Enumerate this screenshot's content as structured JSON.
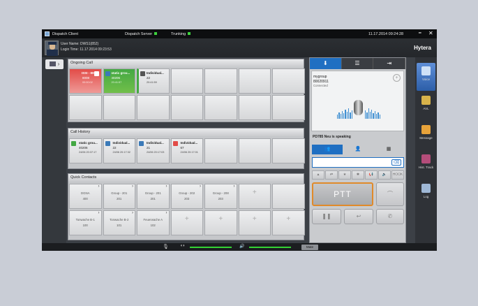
{
  "titlebar": {
    "app_title": "Dispatch Client",
    "server_label": "Dispatch Server",
    "trunking_label": "Trunking",
    "datetime": "11.17.2014 09:24:28",
    "status_color": "#3cd23c"
  },
  "user": {
    "user_name": "User Name: DWS1(852)",
    "login_time": "Login Time: 11.17.2014 09:23:53"
  },
  "brand": "Hytera",
  "ongoing_call": {
    "title": "Ongoing Call",
    "calls": [
      {
        "l1": "ISSI - 8008",
        "l2": "8008",
        "l3": "00:00:02",
        "color": "#e24c48"
      },
      {
        "l1": "static grou...",
        "l2": "40206",
        "l3": "20:41:57",
        "color": "#43a843"
      },
      {
        "l1": "Individual...",
        "l2": "22",
        "l3": "20:41:59",
        "color": "#e6e7e9"
      }
    ]
  },
  "call_history": {
    "title": "Call History",
    "items": [
      {
        "l1": "static grou...",
        "l2": "40206",
        "l3": "24/06 20:37:17"
      },
      {
        "l1": "Individual...",
        "l2": "22",
        "l3": "24/06 20:17:32"
      },
      {
        "l1": "Individual...",
        "l2": "21",
        "l3": "24/06 20:17:03"
      },
      {
        "l1": "Individual...",
        "l2": "67",
        "l3": "24/06 20:17:01"
      }
    ]
  },
  "quick_contacts": {
    "title": "Quick Contacts",
    "row1": [
      {
        "name": "DGNA",
        "id": "400"
      },
      {
        "name": "Group - 201",
        "id": "201"
      },
      {
        "name": "Group - 201",
        "id": "201"
      },
      {
        "name": "Group - 202",
        "id": "203"
      },
      {
        "name": "Group - 208",
        "id": "203"
      }
    ],
    "row2": [
      {
        "name": "Tonwache B-1",
        "id": "100"
      },
      {
        "name": "Tonwache B-2",
        "id": "101"
      },
      {
        "name": "Feuerwache A",
        "id": "102"
      }
    ],
    "add_symbol": "+"
  },
  "group_panel": {
    "group_name": "mygroup",
    "group_id": "80020911",
    "status": "Connected",
    "speaking": "PD785 Neu is speaking",
    "hook_label": "HOOK",
    "ptt_label": "PTT"
  },
  "right_nav": [
    {
      "label": "Voice",
      "icon": "voice-icon",
      "active": true
    },
    {
      "label": "AVL",
      "icon": "avl-icon"
    },
    {
      "label": "Message",
      "icon": "message-icon"
    },
    {
      "label": "Hist. Track",
      "icon": "hist-track-icon"
    },
    {
      "label": "Log",
      "icon": "log-icon"
    }
  ],
  "bottom": {
    "mute_label": "Mute",
    "slider_color": "#34d234"
  }
}
